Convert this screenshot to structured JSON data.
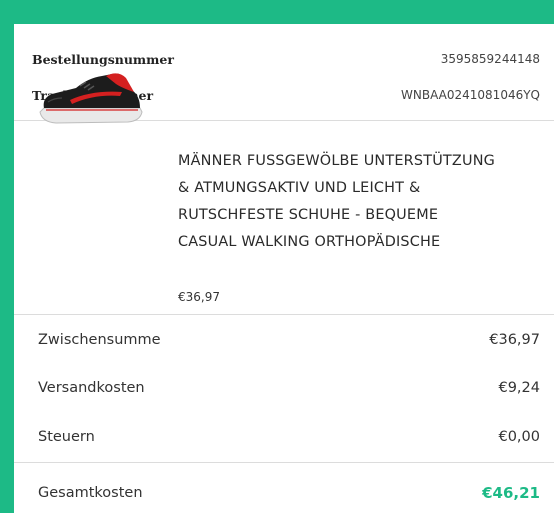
{
  "order": {
    "order_number_label": "Bestellungsnummer",
    "order_number_value": "3595859244148",
    "tracking_label": "Trackingnummer",
    "tracking_value": "WNBAA0241081046YQ"
  },
  "product": {
    "image_icon": "sneaker-image",
    "title": "MÄNNER FUSSGEWÖLBE UNTERSTÜTZUNG & ATMUNGSAKTIV UND LEICHT & RUTSCHFESTE SCHUHE - BEQUEME CASUAL WALKING ORTHOPÄDISCHE",
    "price": "€36,97"
  },
  "summary": {
    "subtotal_label": "Zwischensumme",
    "subtotal_value": "€36,97",
    "shipping_label": "Versandkosten",
    "shipping_value": "€9,24",
    "tax_label": "Steuern",
    "tax_value": "€0,00",
    "total_label": "Gesamtkosten",
    "total_value": "€46,21"
  },
  "colors": {
    "accent": "#1dba86",
    "shoe_body": "#1c1c1c",
    "shoe_accent": "#d42020"
  }
}
